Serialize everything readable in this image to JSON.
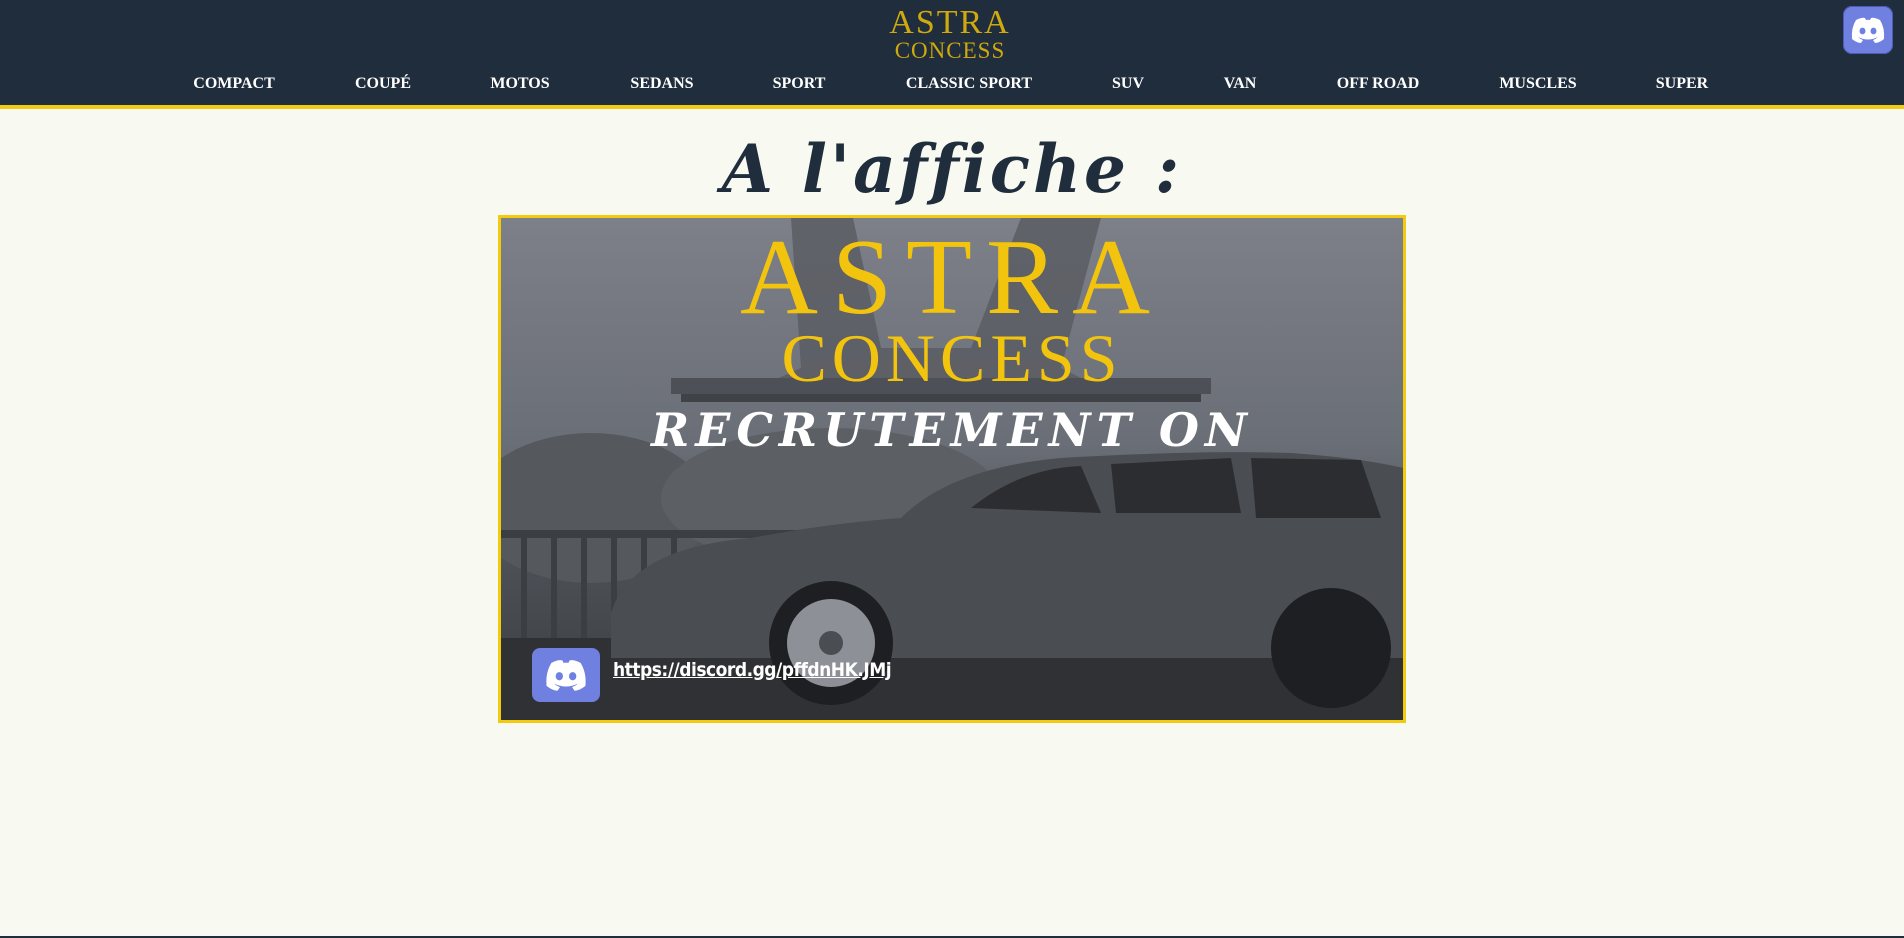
{
  "header": {
    "logo_line1": "ASTRA",
    "logo_line2": "CONCESS",
    "nav": [
      "COMPACT",
      "COUPÉ",
      "MOTOS",
      "SEDANS",
      "SPORT",
      "CLASSIC SPORT",
      "SUV",
      "VAN",
      "OFF ROAD",
      "MUSCLES",
      "SUPER"
    ],
    "discord_icon": "discord-icon"
  },
  "main": {
    "heading": "A l'affiche :",
    "poster": {
      "brand_line1": "ASTRA",
      "brand_line2": "CONCESS",
      "title": "RECRUTEMENT ON",
      "link": "https://discord.gg/pffdnHK.JMj",
      "discord_icon": "discord-icon"
    }
  },
  "colors": {
    "header_bg": "#1f2d3c",
    "accent": "#f2cb11",
    "page_bg": "#f8faf1",
    "discord": "#6f80e0"
  }
}
